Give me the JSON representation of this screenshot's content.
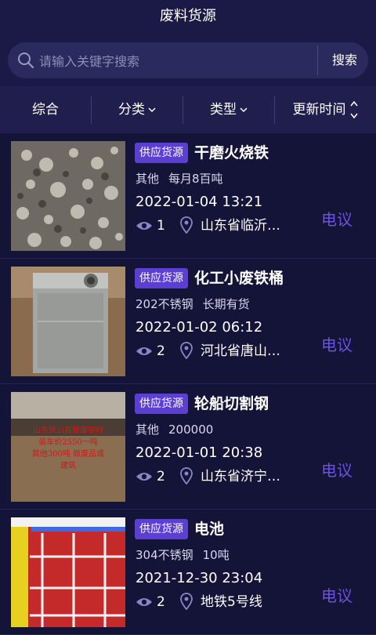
{
  "header": {
    "title": "废料货源"
  },
  "search": {
    "placeholder": "请输入关键字搜索",
    "button_label": "搜索"
  },
  "filters": [
    {
      "label": "综合"
    },
    {
      "label": "分类"
    },
    {
      "label": "类型"
    },
    {
      "label": "更新时间"
    }
  ],
  "items": [
    {
      "badge": "供应货源",
      "title": "干磨火烧铁",
      "meta": [
        "其他",
        "每月8百吨"
      ],
      "date": "2022-01-04 13:21",
      "views": "1",
      "location": "山东省临沂…",
      "call_label": "电议"
    },
    {
      "badge": "供应货源",
      "title": "化工小废铁桶",
      "meta": [
        "202不锈钢",
        "长期有货"
      ],
      "date": "2022-01-02 06:12",
      "views": "2",
      "location": "河北省唐山…",
      "call_label": "电议"
    },
    {
      "badge": "供应货源",
      "title": "轮船切割钢",
      "meta": [
        "其他",
        "200000"
      ],
      "date": "2022-01-01 20:38",
      "views": "2",
      "location": "山东省济宁…",
      "call_label": "电议",
      "image_text": [
        "山东微山县报废钢材",
        "装车价2550一吨",
        "其他300吨 做废品或",
        "建筑"
      ]
    },
    {
      "badge": "供应货源",
      "title": "电池",
      "meta": [
        "304不锈钢",
        "10吨"
      ],
      "date": "2021-12-30 23:04",
      "views": "2",
      "location": "地铁5号线",
      "call_label": "电议"
    }
  ],
  "colors": {
    "accent": "#5a3fd0",
    "call": "#6b52e0",
    "background": "#17163f"
  }
}
